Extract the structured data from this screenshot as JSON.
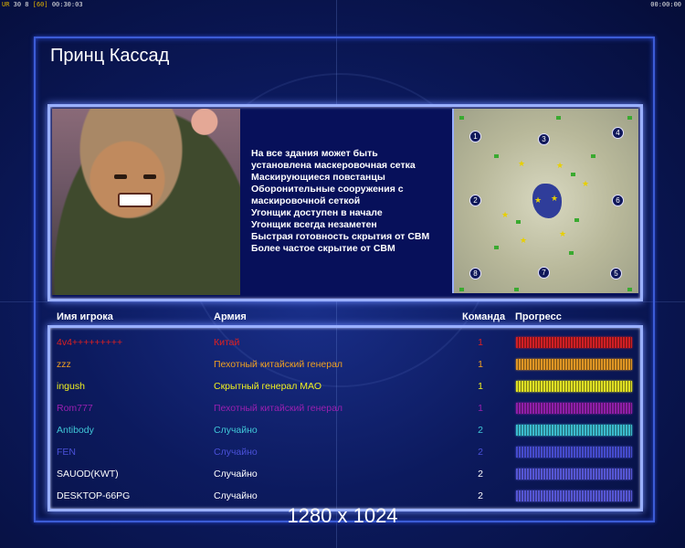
{
  "topbar": {
    "left_prefix": "UR",
    "left_fps": "30 8",
    "left_fps_bracket": "[60]",
    "left_time": "00:30:03",
    "right_time": "00:00:00"
  },
  "title": "Принц Кассад",
  "description": [
    "На все здания может быть",
    " установлена маскеровочная сетка",
    "Маскирующиеся повстанцы",
    "Оборонительные сооружения с",
    " маскировочной сеткой",
    "Угонщик доступен в начале",
    "Угонщик всегда незаметен",
    "Быстрая готовность скрытия от СВМ",
    "Более частое скрытие от СВМ"
  ],
  "minimap": {
    "slots": [
      "1",
      "2",
      "3",
      "4",
      "5",
      "6",
      "7",
      "8"
    ]
  },
  "table": {
    "headers": {
      "player": "Имя игрока",
      "army": "Армия",
      "team": "Команда",
      "progress": "Прогресс"
    },
    "rows": [
      {
        "name": "4v4+++++++++",
        "army": "Китай",
        "team": "1",
        "color": "#e02020",
        "progress": 1.0
      },
      {
        "name": "zzz",
        "army": "Пехотный китайский генерал",
        "team": "1",
        "color": "#f0a020",
        "progress": 1.0
      },
      {
        "name": "ingush",
        "army": "Скрытный генерал МАО",
        "team": "1",
        "color": "#f0f020",
        "progress": 1.0
      },
      {
        "name": "Rom777",
        "army": "Пехотный китайский генерал",
        "team": "1",
        "color": "#9a20b0",
        "progress": 1.0
      },
      {
        "name": "Antibody",
        "army": "Случайно",
        "team": "2",
        "color": "#40c8d8",
        "progress": 1.0
      },
      {
        "name": "FEN",
        "army": "Случайно",
        "team": "2",
        "color": "#4a50d8",
        "progress": 1.0
      },
      {
        "name": "SAUOD(KWT)",
        "army": "Случайно",
        "team": "2",
        "color": "#ffffff",
        "progress": 1.0
      },
      {
        "name": "DESKTOP-66PG",
        "army": "Случайно",
        "team": "2",
        "color": "#ffffff",
        "progress": 1.0
      }
    ]
  },
  "resolution_label": "1280 x 1024",
  "colors": {
    "frame": "#3c5cd6",
    "panel_border": "#9ab0ff",
    "background": "#0c1a5e",
    "progress_bar_purple": "#5c5ce0"
  }
}
